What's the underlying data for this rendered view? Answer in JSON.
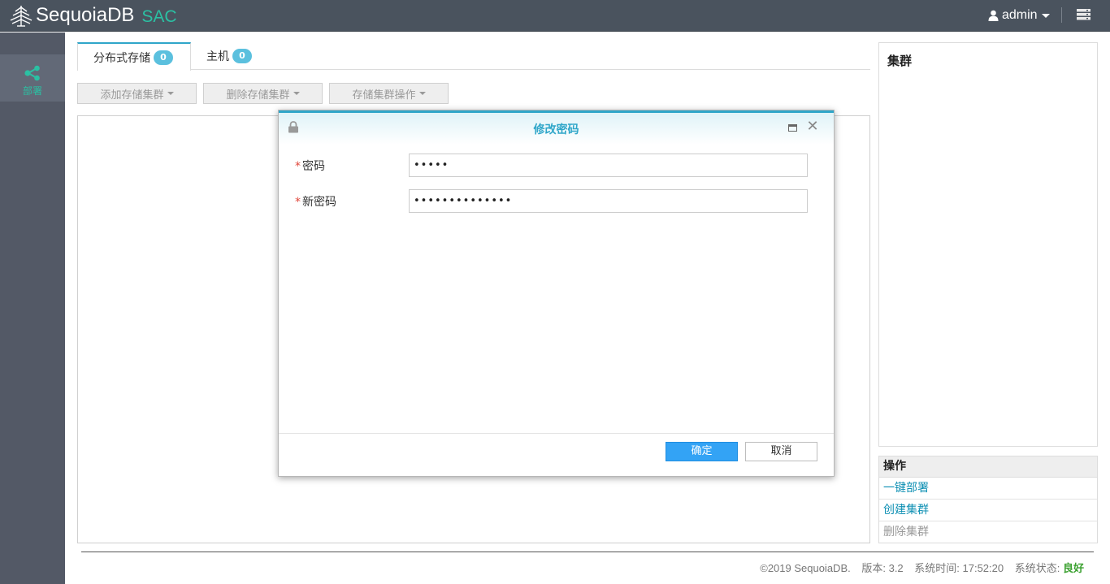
{
  "header": {
    "brand": "SequoiaDB",
    "product": "SAC",
    "user": "admin"
  },
  "nav": {
    "items": [
      {
        "label": "部署",
        "icon": "share-icon",
        "active": true
      }
    ]
  },
  "tabs": [
    {
      "label": "分布式存储",
      "count": "0",
      "active": true
    },
    {
      "label": "主机",
      "count": "0",
      "active": false
    }
  ],
  "toolbar": {
    "add_cluster": "添加存储集群",
    "delete_cluster": "删除存储集群",
    "cluster_ops": "存储集群操作"
  },
  "cluster_panel": {
    "title": "集群"
  },
  "operations": {
    "title": "操作",
    "items": [
      {
        "label": "一键部署",
        "enabled": true
      },
      {
        "label": "创建集群",
        "enabled": true
      },
      {
        "label": "删除集群",
        "enabled": false
      }
    ]
  },
  "footer": {
    "copyright": "©2019 SequoiaDB.",
    "version": "版本: 3.2",
    "system_time": "系统时间: 17:52:20",
    "status_label": "系统状态:",
    "status_value": "良好"
  },
  "modal": {
    "title": "修改密码",
    "fields": [
      {
        "label": "密码",
        "required_mark": "*",
        "masked_value": "•••••"
      },
      {
        "label": "新密码",
        "required_mark": "*",
        "masked_value": "••••••••••••••"
      }
    ],
    "ok_label": "确定",
    "cancel_label": "取消"
  },
  "colors": {
    "topbar": "#4a535e",
    "sidebar": "#535966",
    "accent": "#2fa6c9",
    "brand_green": "#2bc0a3",
    "primary_button": "#33a3f5",
    "link": "#0d8fb3",
    "status_good": "#3aa02f"
  }
}
